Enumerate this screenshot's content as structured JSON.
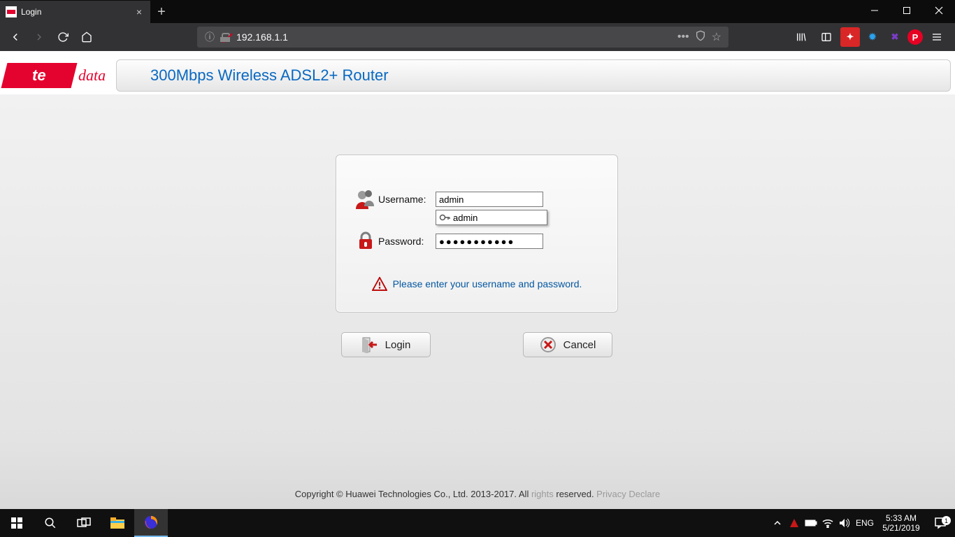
{
  "browser": {
    "tab_title": "Login",
    "url": "192.168.1.1",
    "autocomplete_option": "admin"
  },
  "router": {
    "logo_text": "te",
    "logo_suffix": "data",
    "title": "300Mbps Wireless ADSL2+ Router",
    "username_label": "Username:",
    "username_value": "admin",
    "password_label": "Password:",
    "password_value": "●●●●●●●●●●●",
    "hint": "Please enter your username and password.",
    "login_btn": "Login",
    "cancel_btn": "Cancel",
    "copyright_a": "Copyright © Huawei Technologies Co., Ltd. 2013-2017. All ",
    "copyright_b": "rights",
    "copyright_c": " reserved. ",
    "privacy": "Privacy Declare"
  },
  "taskbar": {
    "lang": "ENG",
    "time": "5:33 AM",
    "date": "5/21/2019",
    "notif_count": "1"
  }
}
